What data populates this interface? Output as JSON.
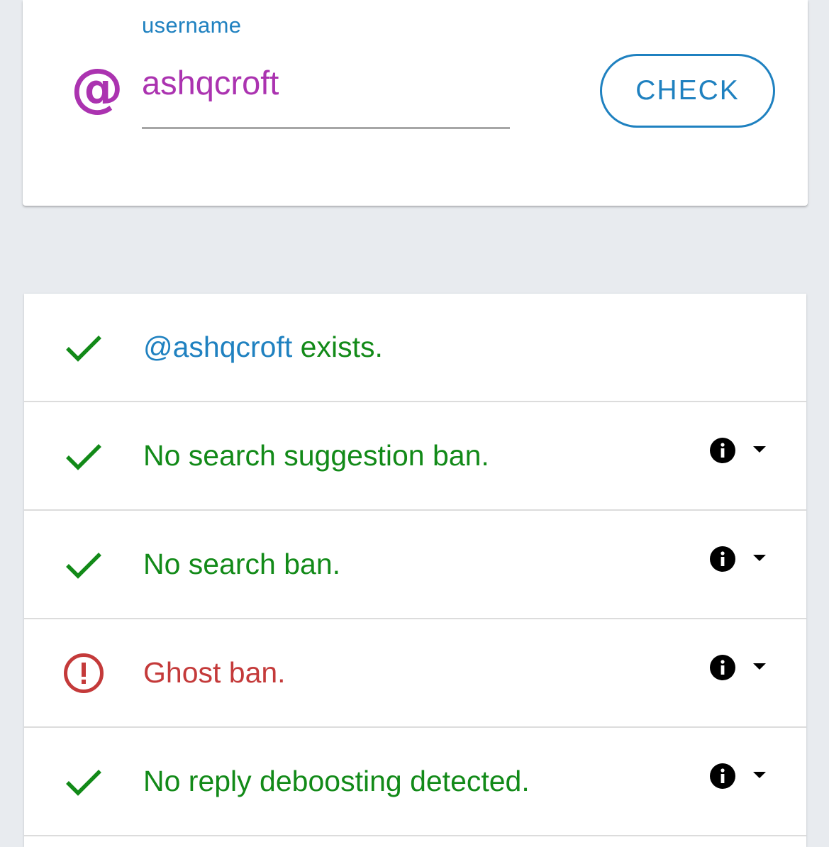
{
  "form": {
    "label": "username",
    "at_icon": "@",
    "value": "ashqcroft",
    "button_label": "CHECK"
  },
  "results": [
    {
      "status": "ok",
      "icon": "check-icon",
      "prefix": "@ashqcroft",
      "text": " exists.",
      "expandable": false
    },
    {
      "status": "ok",
      "icon": "check-icon",
      "prefix": "",
      "text": "No search suggestion ban.",
      "expandable": true
    },
    {
      "status": "ok",
      "icon": "check-icon",
      "prefix": "",
      "text": "No search ban.",
      "expandable": true
    },
    {
      "status": "ban",
      "icon": "alert-circle-icon",
      "prefix": "",
      "text": "Ghost ban.",
      "expandable": true
    },
    {
      "status": "ok",
      "icon": "check-icon",
      "prefix": "",
      "text": "No reply deboosting detected.",
      "expandable": true
    }
  ],
  "colors": {
    "accent_blue": "#1f81c0",
    "username_purple": "#ab33b0",
    "ok_green": "#128a18",
    "ban_red": "#c43a3a",
    "page_background": "#e8ebef"
  }
}
